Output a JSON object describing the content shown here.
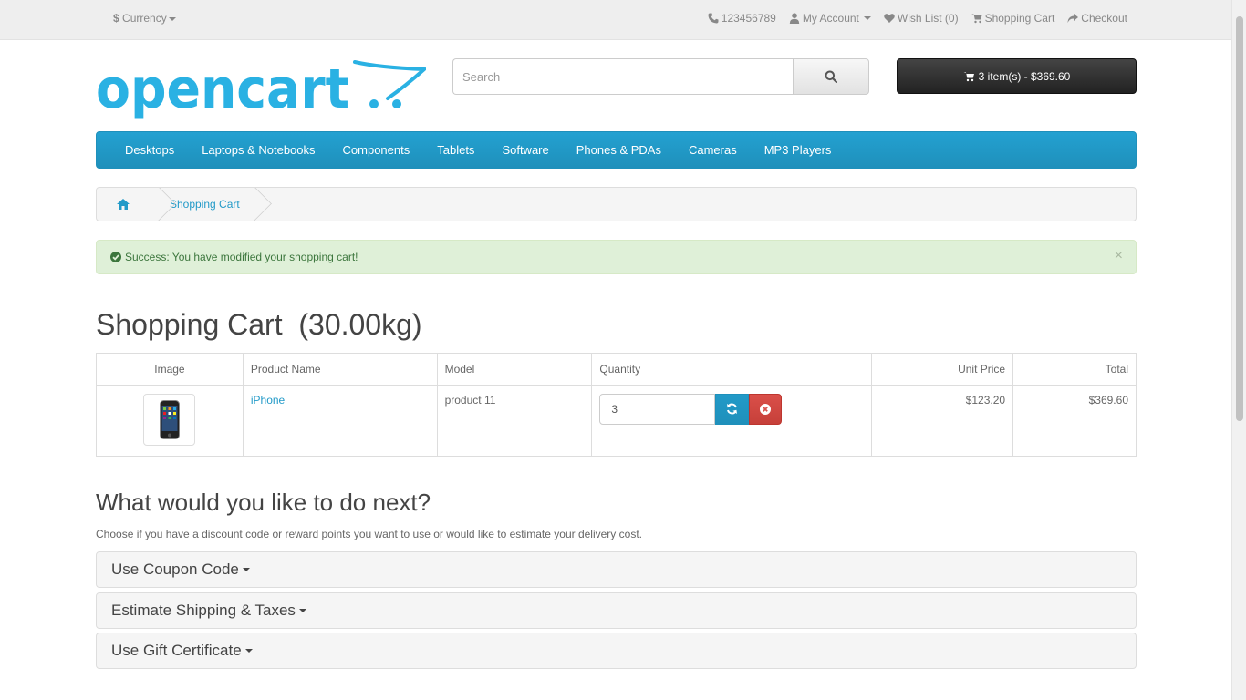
{
  "topbar": {
    "currency": {
      "symbol": "$",
      "label": "Currency"
    },
    "phone": "123456789",
    "account": "My Account",
    "wishlist": "Wish List (0)",
    "cart": "Shopping Cart",
    "checkout": "Checkout"
  },
  "header": {
    "logo_text": "opencart",
    "search_placeholder": "Search",
    "cart_button": "3 item(s) - $369.60"
  },
  "menu": {
    "items": [
      "Desktops",
      "Laptops & Notebooks",
      "Components",
      "Tablets",
      "Software",
      "Phones & PDAs",
      "Cameras",
      "MP3 Players"
    ]
  },
  "breadcrumb": {
    "current": "Shopping Cart"
  },
  "alert": {
    "message": "Success: You have modified your shopping cart!",
    "close": "×"
  },
  "cart": {
    "heading": "Shopping Cart  (30.00kg)",
    "columns": [
      "Image",
      "Product Name",
      "Model",
      "Quantity",
      "Unit Price",
      "Total"
    ],
    "rows": [
      {
        "product": "iPhone",
        "model": "product 11",
        "quantity": "3",
        "unit_price": "$123.20",
        "total": "$369.60"
      }
    ]
  },
  "next": {
    "heading": "What would you like to do next?",
    "description": "Choose if you have a discount code or reward points you want to use or would like to estimate your delivery cost.",
    "panels": [
      "Use Coupon Code",
      "Estimate Shipping & Taxes",
      "Use Gift Certificate"
    ]
  },
  "colors": {
    "accent": "#229ac8",
    "menu": "#229ac8",
    "success_bg": "#dff0d8",
    "danger": "#da4f49"
  }
}
